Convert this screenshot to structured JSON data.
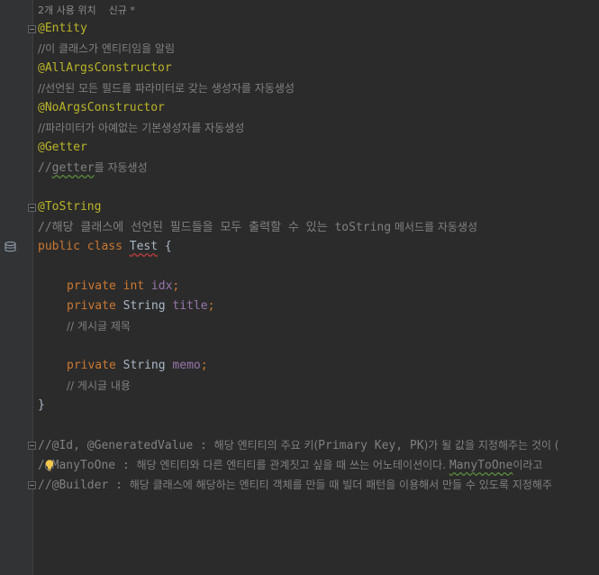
{
  "usage_hint": {
    "usages": "2개 사용 위치",
    "new": "신규 *"
  },
  "code": {
    "l1": "@Entity",
    "l2": "//이 클래스가 엔티티임을 알림",
    "l3": "@AllArgsConstructor",
    "l4": "//선언된 모든 필드를 파라미터로 갖는 생성자를 자동생성",
    "l5": "@NoArgsConstructor",
    "l6": "//파라미터가 아예없는 기본생성자를 자동생성",
    "l7": "@Getter",
    "l8a": "//",
    "l8b": "getter",
    "l8c": "를 자동생성",
    "l10": "@ToString",
    "l11a": "//해당 클래스에 선언된 필드들을 모두 출력할 수 있는 ",
    "l11b": "toString",
    "l11c": " 메서드를 자동생성",
    "l12_kw": "public class ",
    "l12_name": "Test",
    "l12_brace": " {",
    "l14_kw": "private int ",
    "l14_field": "idx",
    "l15_kw": "private ",
    "l15_type": "String ",
    "l15_field": "title",
    "l16": "// 게시글 제목",
    "l18_kw": "private ",
    "l18_type": "String ",
    "l18_field": "memo",
    "l19": "// 게시글 내용",
    "l20": "}",
    "semi": ";",
    "l22a": "//@Id, @GeneratedValue : ",
    "l22b": "해당 엔티티의 주요 키(",
    "l22c": "Primary Key, PK",
    "l22d": ")가 될 값을 지정해주는 것이 (",
    "l23a": "/",
    "l23b": "@ManyToOne : ",
    "l23c": "해당 엔티티와 다른 엔티티를 관계짓고 싶을 때 쓰는 어노테이션이다. ",
    "l23d": "ManyToOne",
    "l23e": "이라고 ",
    "l24a": "//@Builder : ",
    "l24b": "해당 클래스에 해당하는 엔티티 객체를 만들 때 빌더 패턴을 이용해서 만들 수 있도록 지정해주"
  },
  "icons": {
    "fold": "fold-marker-icon",
    "database": "database-icon",
    "bulb": "intention-bulb-icon"
  },
  "colors": {
    "background": "#2b2b2b",
    "annotation": "#bbb529",
    "keyword": "#cc7832",
    "field": "#9876aa",
    "comment": "#808080",
    "text": "#a9b7c6"
  }
}
